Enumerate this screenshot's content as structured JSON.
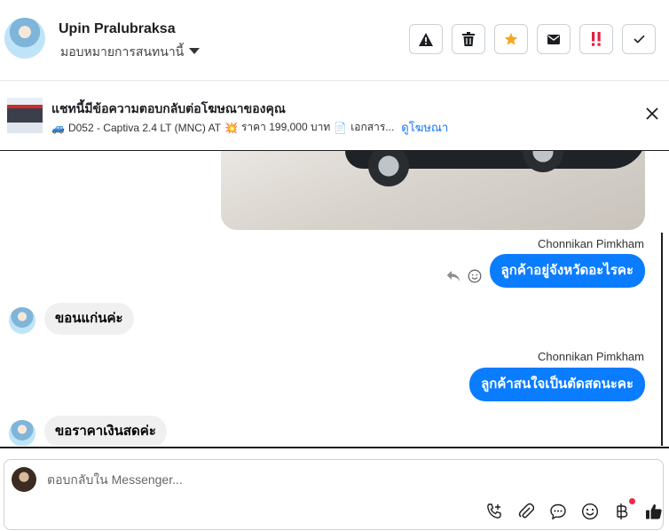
{
  "header": {
    "name": "Upin Pralubraksa",
    "assign_label": "มอบหมายการสนทนานี้",
    "toolbar": [
      {
        "name": "report-spam-button",
        "icon": "warning-icon"
      },
      {
        "name": "delete-button",
        "icon": "trash-icon"
      },
      {
        "name": "star-button",
        "icon": "star-icon"
      },
      {
        "name": "mark-unread-button",
        "icon": "envelope-icon"
      },
      {
        "name": "follow-up-button",
        "icon": "exclamation-icon"
      },
      {
        "name": "mark-done-button",
        "icon": "checkmark-icon"
      }
    ]
  },
  "ad_banner": {
    "title": "แชทนี้มีข้อความตอบกลับต่อโฆษณาของคุณ",
    "car_emoji": "🚙",
    "ad_text": "D052 - Captiva 2.4 LT (MNC) AT",
    "burst_emoji": "💥",
    "price_text": "ราคา 199,000 บาท",
    "doc_emoji": "📄",
    "doc_text": "เอกสาร...",
    "link": "ดูโฆษณา"
  },
  "messages": [
    {
      "sender": "Chonnikan Pimkham",
      "text": "ลูกค้าอยู่จังหวัดอะไรคะ",
      "direction": "out"
    },
    {
      "text": "ขอนแก่นค่ะ",
      "direction": "in"
    },
    {
      "sender": "Chonnikan Pimkham",
      "text": "ลูกค้าสนใจเป็นตัดสดนะคะ",
      "direction": "out"
    },
    {
      "text": "ขอราคาเงินสดค่ะ",
      "direction": "in"
    }
  ],
  "composer": {
    "placeholder": "ตอบกลับใน Messenger...",
    "tools": [
      "phone-add-icon",
      "paperclip-icon",
      "saved-replies-icon",
      "emoji-icon",
      "baht-payment-icon",
      "thumbs-up-icon"
    ]
  },
  "colors": {
    "accent": "#0a7cff",
    "incoming_bubble": "#f0f0f0",
    "star": "#f5a623",
    "follow_up": "#e41e3f"
  }
}
